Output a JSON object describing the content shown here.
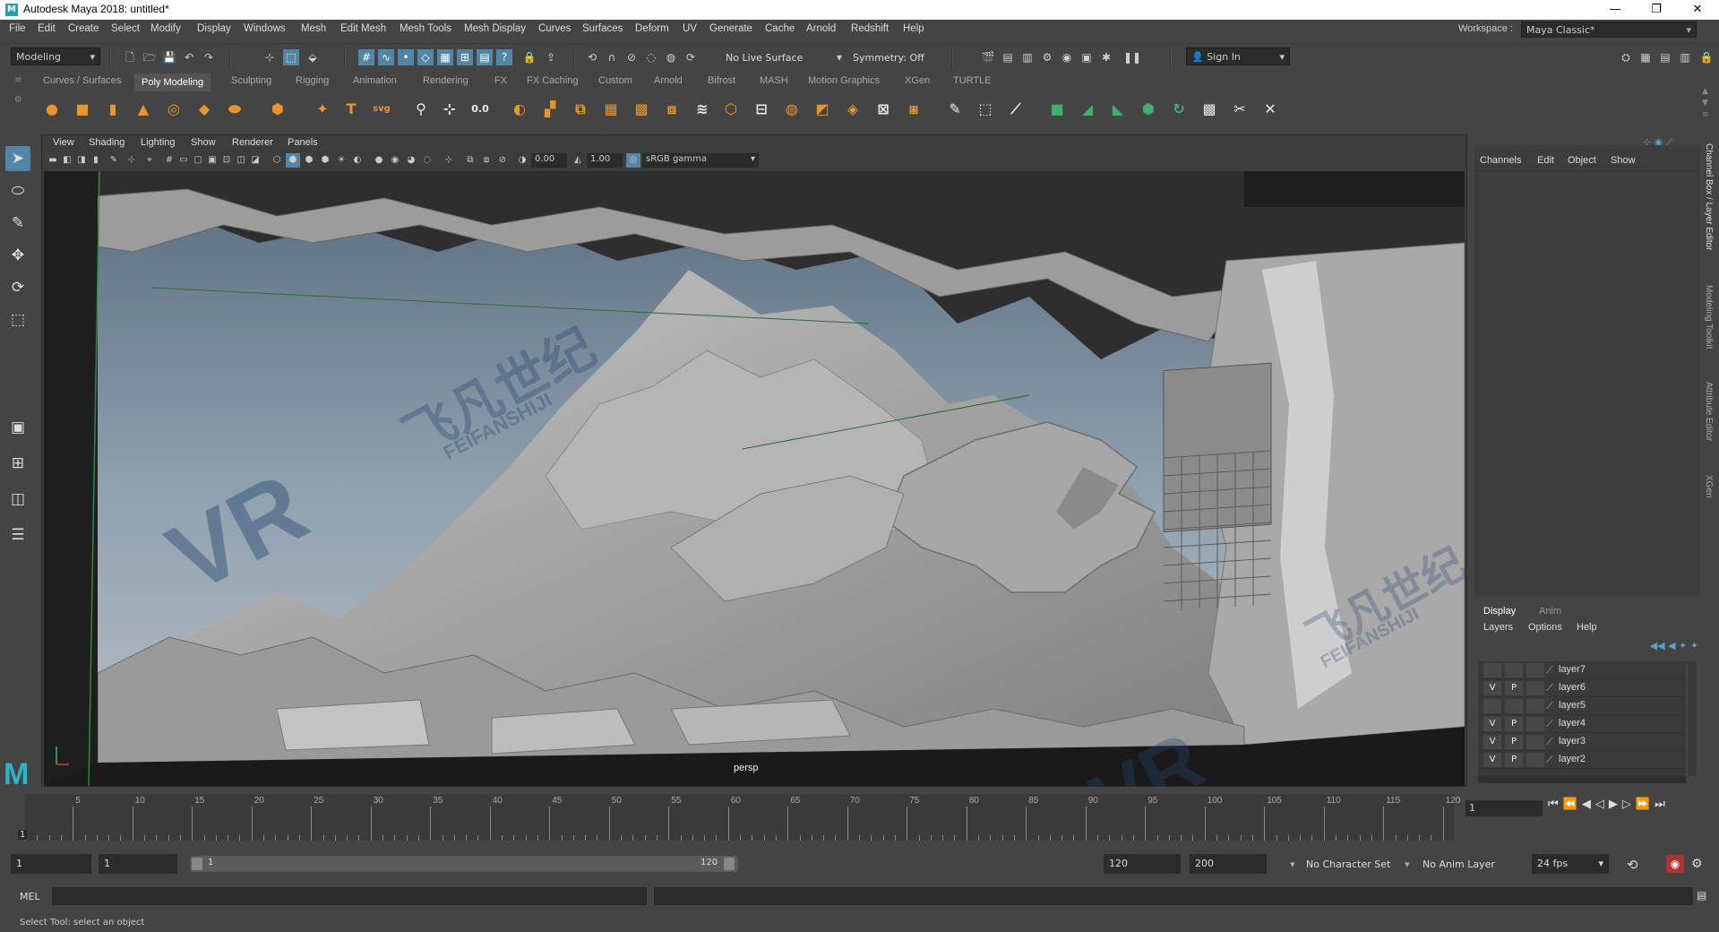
{
  "window": {
    "title": "Autodesk Maya 2018: untitled*",
    "minimize": "—",
    "restore": "❐",
    "close": "✕"
  },
  "menubar": {
    "items": [
      "File",
      "Edit",
      "Create",
      "Select",
      "Modify",
      "Display",
      "Windows",
      "Mesh",
      "Edit Mesh",
      "Mesh Tools",
      "Mesh Display",
      "Curves",
      "Surfaces",
      "Deform",
      "UV",
      "Generate",
      "Cache",
      "Arnold",
      "Redshift",
      "Help"
    ],
    "workspace_label": "Workspace :",
    "workspace_value": "Maya Classic*"
  },
  "statusline": {
    "menuset": "Modeling",
    "live_surface": "No Live Surface",
    "symmetry": "Symmetry: Off",
    "sign_in": "Sign In"
  },
  "shelf": {
    "tabs": [
      "Curves / Surfaces",
      "Poly Modeling",
      "Sculpting",
      "Rigging",
      "Animation",
      "Rendering",
      "FX",
      "FX Caching",
      "Custom",
      "Arnold",
      "Bifrost",
      "MASH",
      "Motion Graphics",
      "XGen",
      "TURTLE"
    ],
    "active_tab": "Poly Modeling"
  },
  "viewport": {
    "menus": [
      "View",
      "Shading",
      "Lighting",
      "Show",
      "Renderer",
      "Panels"
    ],
    "exposure": "0.00",
    "gamma": "1.00",
    "color_space": "sRGB gamma",
    "camera": "persp",
    "watermark_cn": "飞凡世纪",
    "watermark_en": "FEIFANSHIJI",
    "watermark_logo": "VR"
  },
  "channel_box": {
    "menus": [
      "Channels",
      "Edit",
      "Object",
      "Show"
    ]
  },
  "side_tabs": [
    "Channel Box / Layer Editor",
    "Modeling Toolkit",
    "Attribute Editor",
    "XGen"
  ],
  "layer_editor": {
    "tabs": [
      "Display",
      "Anim"
    ],
    "menus": [
      "Layers",
      "Options",
      "Help"
    ],
    "layers": [
      {
        "name": "layer7",
        "v": "",
        "p": ""
      },
      {
        "name": "layer6",
        "v": "V",
        "p": "P"
      },
      {
        "name": "layer5",
        "v": "",
        "p": ""
      },
      {
        "name": "layer4",
        "v": "V",
        "p": "P"
      },
      {
        "name": "layer3",
        "v": "V",
        "p": "P"
      },
      {
        "name": "layer2",
        "v": "V",
        "p": "P"
      }
    ]
  },
  "timeline": {
    "ticks": [
      "5",
      "10",
      "15",
      "20",
      "25",
      "30",
      "35",
      "40",
      "45",
      "50",
      "55",
      "60",
      "65",
      "70",
      "75",
      "80",
      "85",
      "90",
      "95",
      "100",
      "105",
      "110",
      "115",
      "120"
    ],
    "current_frame": "1",
    "current_time_field": "1"
  },
  "range": {
    "start": "1",
    "anim_start": "1",
    "slider_start": "1",
    "slider_end": "120",
    "anim_end_field": "120",
    "end": "200",
    "character_set": "No Character Set",
    "anim_layer": "No Anim Layer",
    "fps": "24 fps"
  },
  "commandline": {
    "label": "MEL"
  },
  "helpline": {
    "text": "Select Tool: select an object"
  }
}
